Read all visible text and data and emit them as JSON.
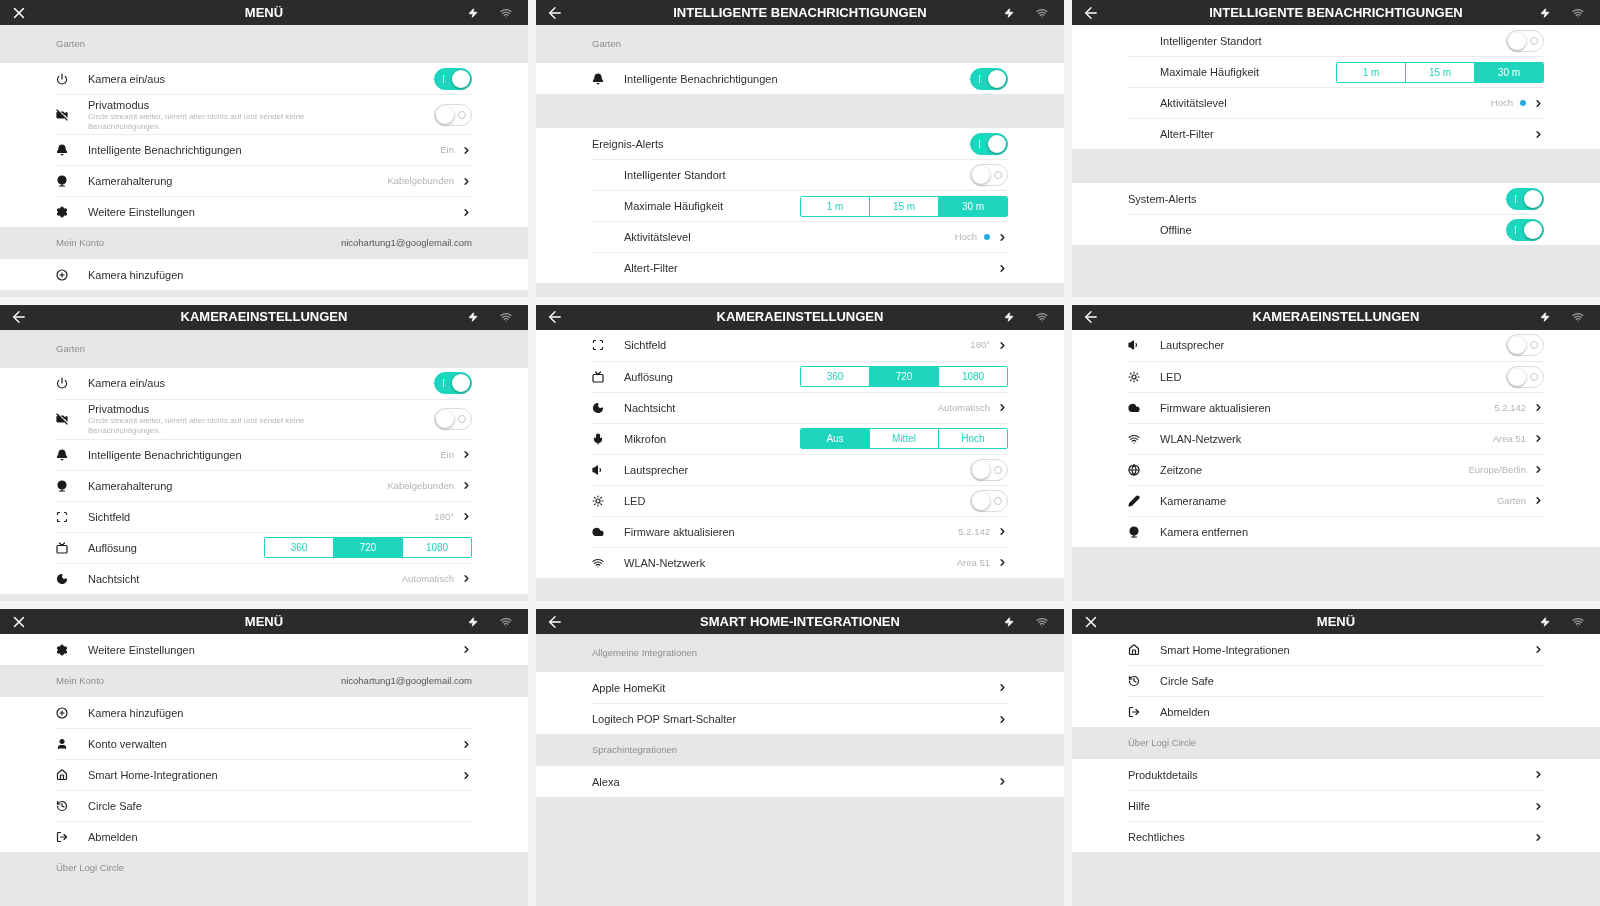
{
  "panels": [
    {
      "title": "MENÜ",
      "items": [
        {
          "kind": "section",
          "label": "Garten"
        },
        {
          "kind": "toggle",
          "label": "Kamera ein/aus",
          "on": true
        },
        {
          "kind": "toggle",
          "label": "Privatmodus",
          "description": "Circle streamt weiter, nimmt aber nichts auf und sendet keine Benachrichtigungen.",
          "on": false
        },
        {
          "kind": "link",
          "label": "Intelligente Benachrichtigungen",
          "value": "Ein",
          "chevron": true
        },
        {
          "kind": "link",
          "label": "Kamerahalterung",
          "value": "Kabelgebunden",
          "chevron": true
        },
        {
          "kind": "link",
          "label": "Weitere Einstellungen",
          "chevron": true
        },
        {
          "kind": "section",
          "label": "Mein Konto",
          "value": "nicohartung1@googlemail.com"
        },
        {
          "kind": "link",
          "label": "Kamera hinzufügen",
          "chevron": false
        }
      ]
    },
    {
      "title": "INTELLIGENTE BENACHRICHTIGUNGEN",
      "items": [
        {
          "kind": "section",
          "label": "Garten"
        },
        {
          "kind": "toggle",
          "label": "Intelligente Benachrichtigungen",
          "on": true
        },
        {
          "kind": "gap"
        },
        {
          "kind": "toggle",
          "label": "Ereignis-Alerts",
          "on": true
        },
        {
          "kind": "toggle",
          "label": "Intelligenter Standort",
          "on": false
        },
        {
          "kind": "segmented",
          "label": "Maximale Häufigkeit",
          "options": [
            {
              "label": "1 m",
              "selected": false
            },
            {
              "label": "15 m",
              "selected": false
            },
            {
              "label": "30 m",
              "selected": true
            }
          ]
        },
        {
          "kind": "link",
          "label": "Aktivitätslevel",
          "value": "Hoch",
          "color": "#29abe2",
          "chevron": true
        },
        {
          "kind": "link",
          "label": "Altert-Filter",
          "chevron": true
        }
      ]
    },
    {
      "title": "INTELLIGENTE BENACHRICHTIGUNGEN",
      "items": [
        {
          "kind": "toggle",
          "label": "Intelligenter Standort",
          "on": false
        },
        {
          "kind": "segmented",
          "label": "Maximale Häufigkeit",
          "options": [
            {
              "label": "1 m",
              "selected": false
            },
            {
              "label": "15 m",
              "selected": false
            },
            {
              "label": "30 m",
              "selected": true
            }
          ]
        },
        {
          "kind": "link",
          "label": "Aktivitätslevel",
          "value": "Hoch",
          "color": "#29abe2",
          "chevron": true
        },
        {
          "kind": "link",
          "label": "Altert-Filter",
          "chevron": true
        },
        {
          "kind": "gap"
        },
        {
          "kind": "toggle",
          "label": "System-Alerts",
          "on": true
        },
        {
          "kind": "toggle",
          "label": "Offline",
          "on": true
        }
      ]
    },
    {
      "title": "KAMERAEINSTELLUNGEN",
      "items": [
        {
          "kind": "section",
          "label": "Garten"
        },
        {
          "kind": "toggle",
          "label": "Kamera ein/aus",
          "on": true
        },
        {
          "kind": "toggle",
          "label": "Privatmodus",
          "description": "Circle streamt weiter, nimmt aber nichts auf und sendet keine Benachrichtigungen.",
          "on": false
        },
        {
          "kind": "link",
          "label": "Intelligente Benachrichtigungen",
          "value": "Ein",
          "chevron": true
        },
        {
          "kind": "link",
          "label": "Kamerahalterung",
          "value": "Kabelgebunden",
          "chevron": true
        },
        {
          "kind": "link",
          "label": "Sichtfeld",
          "value": "180°",
          "chevron": true
        },
        {
          "kind": "segmented",
          "label": "Auflösung",
          "options": [
            {
              "label": "360",
              "selected": false
            },
            {
              "label": "720",
              "selected": true
            },
            {
              "label": "1080",
              "selected": false
            }
          ]
        },
        {
          "kind": "link",
          "label": "Nachtsicht",
          "value": "Automatisch",
          "chevron": true
        }
      ]
    },
    {
      "title": "KAMERAEINSTELLUNGEN",
      "items": [
        {
          "kind": "link",
          "label": "Sichtfeld",
          "value": "180°",
          "chevron": true
        },
        {
          "kind": "segmented",
          "label": "Auflösung",
          "options": [
            {
              "label": "360",
              "selected": false
            },
            {
              "label": "720",
              "selected": true
            },
            {
              "label": "1080",
              "selected": false
            }
          ]
        },
        {
          "kind": "link",
          "label": "Nachtsicht",
          "value": "Automatisch",
          "chevron": true
        },
        {
          "kind": "segmented",
          "label": "Mikrofon",
          "options": [
            {
              "label": "Aus",
              "selected": true
            },
            {
              "label": "Mittel",
              "selected": false
            },
            {
              "label": "Hoch",
              "selected": false
            }
          ]
        },
        {
          "kind": "toggle",
          "label": "Lautsprecher",
          "on": false
        },
        {
          "kind": "toggle",
          "label": "LED",
          "on": false
        },
        {
          "kind": "link",
          "label": "Firmware aktualisieren",
          "value": "5.2.142",
          "chevron": true
        },
        {
          "kind": "link",
          "label": "WLAN-Netzwerk",
          "value": "Area 51",
          "chevron": true
        }
      ]
    },
    {
      "title": "KAMERAEINSTELLUNGEN",
      "items": [
        {
          "kind": "toggle",
          "label": "Lautsprecher",
          "on": false
        },
        {
          "kind": "toggle",
          "label": "LED",
          "on": false
        },
        {
          "kind": "link",
          "label": "Firmware aktualisieren",
          "value": "5.2.142",
          "chevron": true
        },
        {
          "kind": "link",
          "label": "WLAN-Netzwerk",
          "value": "Area 51",
          "chevron": true
        },
        {
          "kind": "link",
          "label": "Zeitzone",
          "value": "Europe/Berlin",
          "chevron": true
        },
        {
          "kind": "link",
          "label": "Kameraname",
          "value": "Garten",
          "chevron": true
        },
        {
          "kind": "link",
          "label": "Kamera entfernen",
          "chevron": false
        }
      ]
    },
    {
      "title": "MENÜ",
      "items": [
        {
          "kind": "link",
          "label": "Weitere Einstellungen",
          "chevron": true
        },
        {
          "kind": "section",
          "label": "Mein Konto",
          "value": "nicohartung1@googlemail.com"
        },
        {
          "kind": "link",
          "label": "Kamera hinzufügen",
          "chevron": false
        },
        {
          "kind": "link",
          "label": "Konto verwalten",
          "chevron": true
        },
        {
          "kind": "link",
          "label": "Smart Home-Integrationen",
          "chevron": true
        },
        {
          "kind": "link",
          "label": "Circle Safe",
          "chevron": false
        },
        {
          "kind": "link",
          "label": "Abmelden",
          "chevron": false
        },
        {
          "kind": "section",
          "label": "Über Logi Circle"
        }
      ]
    },
    {
      "title": "SMART HOME-INTEGRATIONEN",
      "items": [
        {
          "kind": "section",
          "label": "Allgemeine Integrationen"
        },
        {
          "kind": "link",
          "label": "Apple HomeKit",
          "chevron": true
        },
        {
          "kind": "link",
          "label": "Logitech POP Smart-Schalter",
          "chevron": true
        },
        {
          "kind": "section",
          "label": "Sprachintegrationen"
        },
        {
          "kind": "link",
          "label": "Alexa",
          "chevron": true
        }
      ]
    },
    {
      "title": "MENÜ",
      "items": [
        {
          "kind": "link",
          "label": "Smart Home-Integrationen",
          "chevron": true
        },
        {
          "kind": "link",
          "label": "Circle Safe",
          "chevron": false
        },
        {
          "kind": "link",
          "label": "Abmelden",
          "chevron": false
        },
        {
          "kind": "section",
          "label": "Über Logi Circle"
        },
        {
          "kind": "link",
          "label": "Produktdetails",
          "chevron": true
        },
        {
          "kind": "link",
          "label": "Hilfe",
          "chevron": true
        },
        {
          "kind": "link",
          "label": "Rechtliches",
          "chevron": true
        }
      ]
    }
  ]
}
